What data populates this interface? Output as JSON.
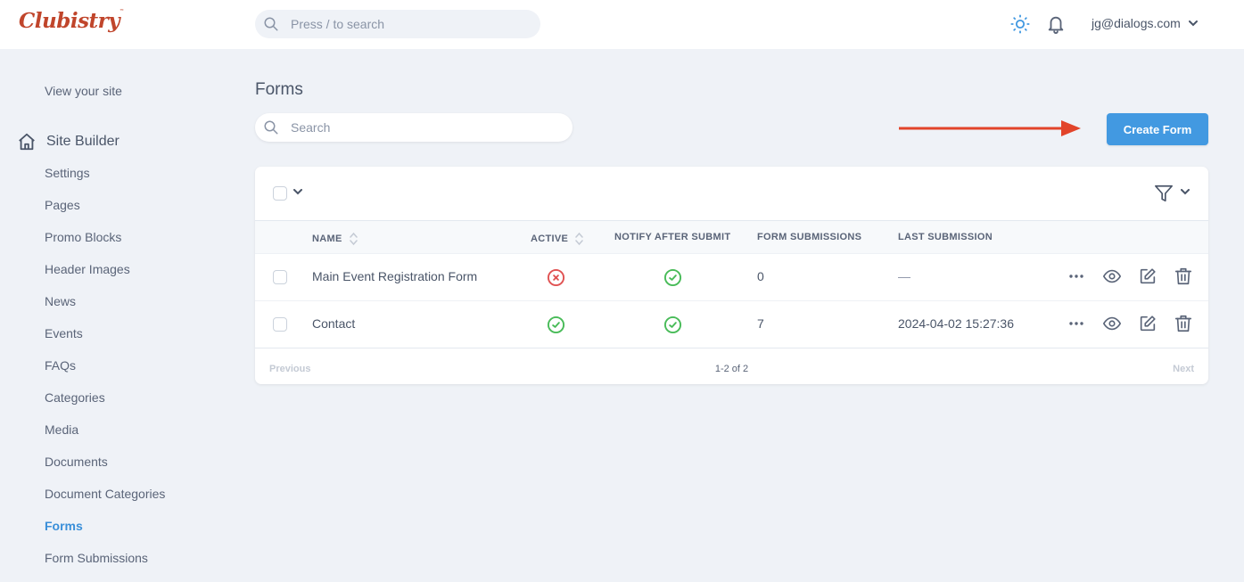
{
  "app": {
    "logo_text": "Clubistry",
    "search_placeholder": "Press / to search",
    "user_email": "jg@dialogs.com"
  },
  "sidebar": {
    "view_site_label": "View your site",
    "section_label": "Site Builder",
    "items": [
      {
        "label": "Settings",
        "active": false
      },
      {
        "label": "Pages",
        "active": false
      },
      {
        "label": "Promo Blocks",
        "active": false
      },
      {
        "label": "Header Images",
        "active": false
      },
      {
        "label": "News",
        "active": false
      },
      {
        "label": "Events",
        "active": false
      },
      {
        "label": "FAQs",
        "active": false
      },
      {
        "label": "Categories",
        "active": false
      },
      {
        "label": "Media",
        "active": false
      },
      {
        "label": "Documents",
        "active": false
      },
      {
        "label": "Document Categories",
        "active": false
      },
      {
        "label": "Forms",
        "active": true
      },
      {
        "label": "Form Submissions",
        "active": false
      }
    ]
  },
  "main": {
    "title": "Forms",
    "search_placeholder": "Search",
    "create_button_label": "Create Form",
    "table": {
      "columns": [
        "NAME",
        "ACTIVE",
        "NOTIFY AFTER SUBMIT",
        "FORM SUBMISSIONS",
        "LAST SUBMISSION"
      ],
      "rows": [
        {
          "name": "Main Event Registration Form",
          "active": false,
          "notify": true,
          "submissions": "0",
          "last_submission": "—"
        },
        {
          "name": "Contact",
          "active": true,
          "notify": true,
          "submissions": "7",
          "last_submission": "2024-04-02 15:27:36"
        }
      ]
    },
    "pagination": {
      "previous_label": "Previous",
      "count_label": "1-2 of 2",
      "next_label": "Next"
    }
  },
  "colors": {
    "brand": "#c0452b",
    "accent": "#4299e1",
    "active_link": "#3a8fd9",
    "success": "#48bb58",
    "danger": "#e05252",
    "annotation_arrow": "#e2442a"
  }
}
